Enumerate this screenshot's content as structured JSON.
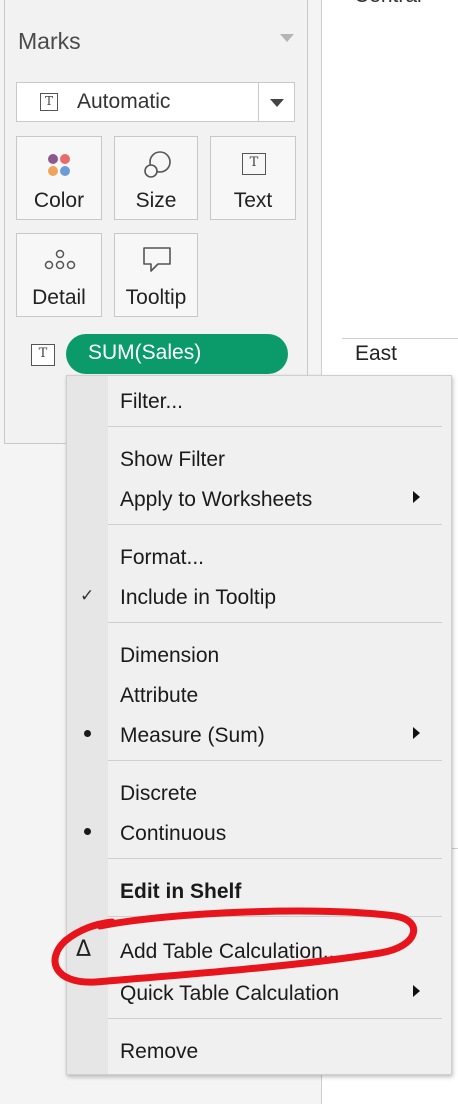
{
  "marks": {
    "title": "Marks",
    "mark_type": {
      "label": "Automatic",
      "icon_glyph": "T"
    },
    "buttons": {
      "color": "Color",
      "size": "Size",
      "text": "Text",
      "text_icon_glyph": "T",
      "detail": "Detail",
      "tooltip": "Tooltip"
    },
    "pill": {
      "label": "SUM(Sales)",
      "icon_glyph": "T",
      "color": "#0b9b6b"
    }
  },
  "view": {
    "rows": [
      "Central",
      "East"
    ]
  },
  "context_menu": {
    "items": {
      "filter": "Filter...",
      "show_filter": "Show Filter",
      "apply_to_worksheets": "Apply to Worksheets",
      "format": "Format...",
      "include_in_tooltip": "Include in Tooltip",
      "dimension": "Dimension",
      "attribute": "Attribute",
      "measure_sum": "Measure (Sum)",
      "discrete": "Discrete",
      "continuous": "Continuous",
      "edit_in_shelf": "Edit in Shelf",
      "add_table_calculation": "Add Table Calculation...",
      "quick_table_calculation": "Quick Table Calculation",
      "remove": "Remove"
    },
    "checkmark_glyph": "✓",
    "delta_glyph": "Δ"
  },
  "annotation": {
    "color": "#e8141c"
  }
}
